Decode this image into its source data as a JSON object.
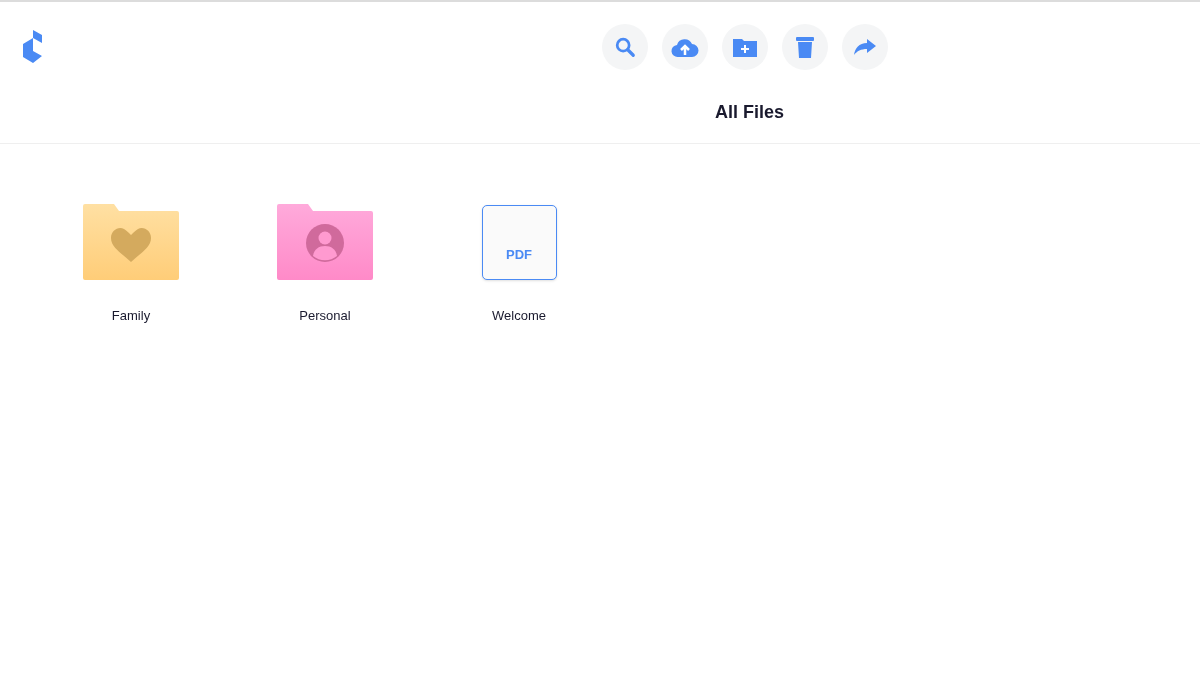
{
  "toolbar": [
    {
      "kind": "search"
    },
    {
      "kind": "upload"
    },
    {
      "kind": "new-folder"
    },
    {
      "kind": "delete"
    },
    {
      "kind": "share"
    }
  ],
  "title": "All Files",
  "items": [
    {
      "kind": "folder-heart",
      "name": "Family"
    },
    {
      "kind": "folder-person",
      "name": "Personal"
    },
    {
      "kind": "pdf",
      "name": "Welcome",
      "badge": "PDF"
    }
  ]
}
